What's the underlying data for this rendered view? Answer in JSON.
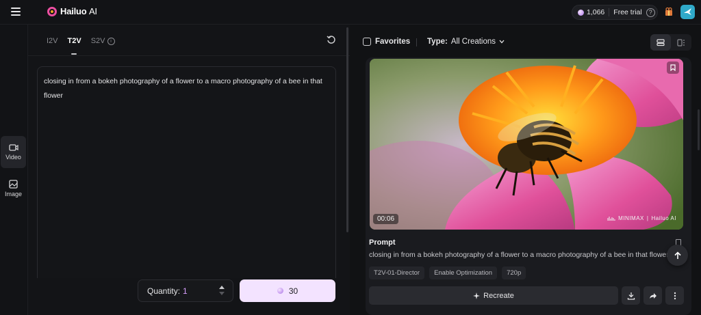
{
  "header": {
    "logo_text": "Hailuo",
    "logo_suffix": "AI",
    "credits": "1,066",
    "trial_label": "Free trial",
    "help_glyph": "?"
  },
  "sidebar": {
    "items": [
      {
        "label": "Video",
        "icon": "video-icon",
        "active": true
      },
      {
        "label": "Image",
        "icon": "image-icon",
        "active": false
      }
    ]
  },
  "left": {
    "tabs": [
      {
        "label": "I2V",
        "active": false
      },
      {
        "label": "T2V",
        "active": true
      },
      {
        "label": "S2V",
        "active": false,
        "info": true
      }
    ],
    "prompt": "closing in from a bokeh photography of a flower to a macro photography of a bee in that flower",
    "quantity_label": "Quantity:",
    "quantity_value": "1",
    "generate_cost": "30"
  },
  "right": {
    "favorites_label": "Favorites",
    "type_label": "Type:",
    "type_value": "All Creations",
    "card": {
      "duration": "00:06",
      "watermark_left": "MINIMAX",
      "watermark_right": "Hailuo AI",
      "prompt_heading": "Prompt",
      "prompt_text": "closing in from a bokeh photography of a flower to a macro photography of a bee in that flower",
      "chips": [
        "T2V-01-Director",
        "Enable Optimization",
        "720p"
      ],
      "recreate_label": "Recreate"
    }
  },
  "colors": {
    "accent_pink": "#ec4fa0",
    "generate_bg": "#f3e3ff",
    "qty_value": "#d9a0ff"
  }
}
